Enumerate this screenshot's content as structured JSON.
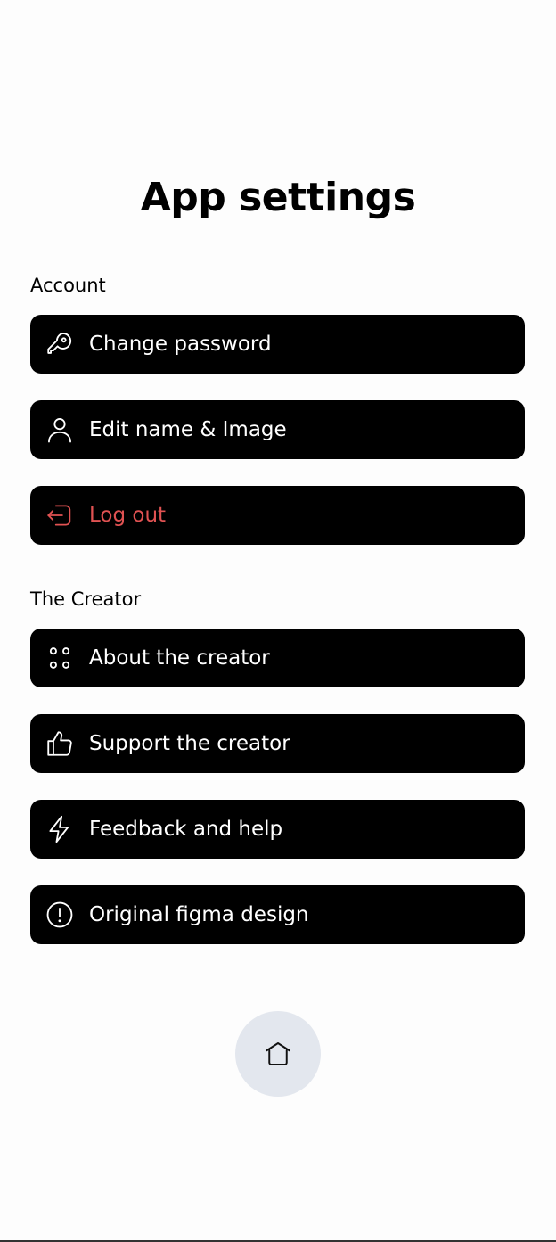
{
  "page": {
    "title": "App settings"
  },
  "sections": {
    "account": {
      "label": "Account",
      "items": [
        {
          "label": "Change password",
          "icon": "key-icon"
        },
        {
          "label": "Edit name & Image",
          "icon": "user-icon"
        },
        {
          "label": "Log out",
          "icon": "logout-icon",
          "color": "#e05252"
        }
      ]
    },
    "creator": {
      "label": "The Creator",
      "items": [
        {
          "label": "About the creator",
          "icon": "dots-grid-icon"
        },
        {
          "label": "Support the creator",
          "icon": "thumbs-up-icon"
        },
        {
          "label": "Feedback and help",
          "icon": "lightning-icon"
        },
        {
          "label": "Original figma design",
          "icon": "info-circle-icon"
        }
      ]
    }
  },
  "nav": {
    "home_icon": "home-icon"
  },
  "colors": {
    "button_bg": "#000000",
    "button_text": "#ffffff",
    "danger": "#e05252",
    "home_bg": "#e3e7ee"
  }
}
